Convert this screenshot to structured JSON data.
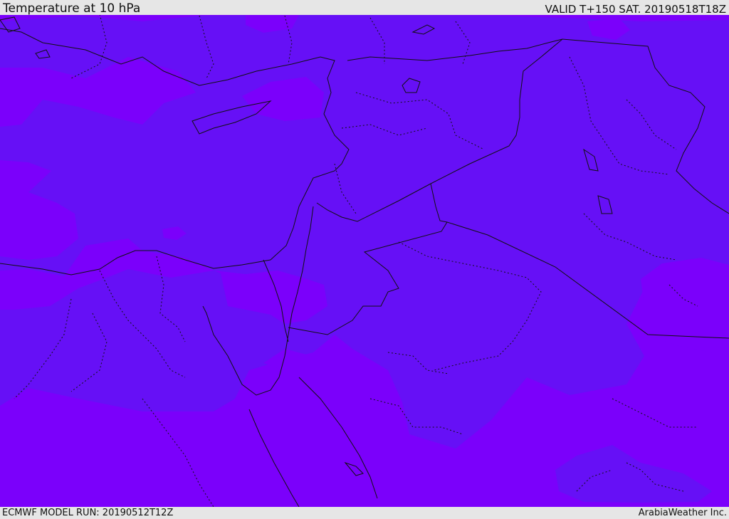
{
  "header": {
    "title": "Temperature at 10 hPa",
    "valid_time": "VALID T+150 SAT. 20190518T18Z"
  },
  "footer": {
    "model_run": "ECMWF MODEL RUN: 20190512T12Z",
    "credit": "ArabiaWeather Inc."
  },
  "colors": {
    "warm_band": "#7b00fb",
    "cool_band": "#6610f6",
    "borders": "#111111",
    "chrome": "#e6e6e6"
  }
}
